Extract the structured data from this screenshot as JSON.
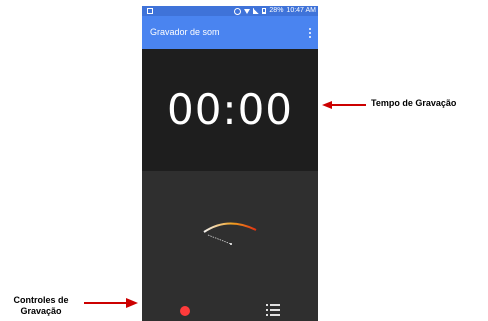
{
  "status_bar": {
    "battery": "28%",
    "time": "10:47 AM"
  },
  "app_bar": {
    "title": "Gravador de som",
    "overflow_icon": "overflow-menu-icon"
  },
  "timer": {
    "value": "00:00"
  },
  "controls": {
    "record_icon": "record-icon",
    "record_color": "#ff3b3b",
    "list_icon": "recordings-list-icon"
  },
  "annotations": {
    "recording_time": "Tempo de Gravação",
    "recording_controls_line1": "Controles de",
    "recording_controls_line2": "Gravação",
    "arrow_color": "#cc0000"
  },
  "colors": {
    "status_bar": "#3f73d9",
    "app_bar": "#4a84f0",
    "timer_panel": "#1e1e1e",
    "body": "#2f2f2f"
  }
}
